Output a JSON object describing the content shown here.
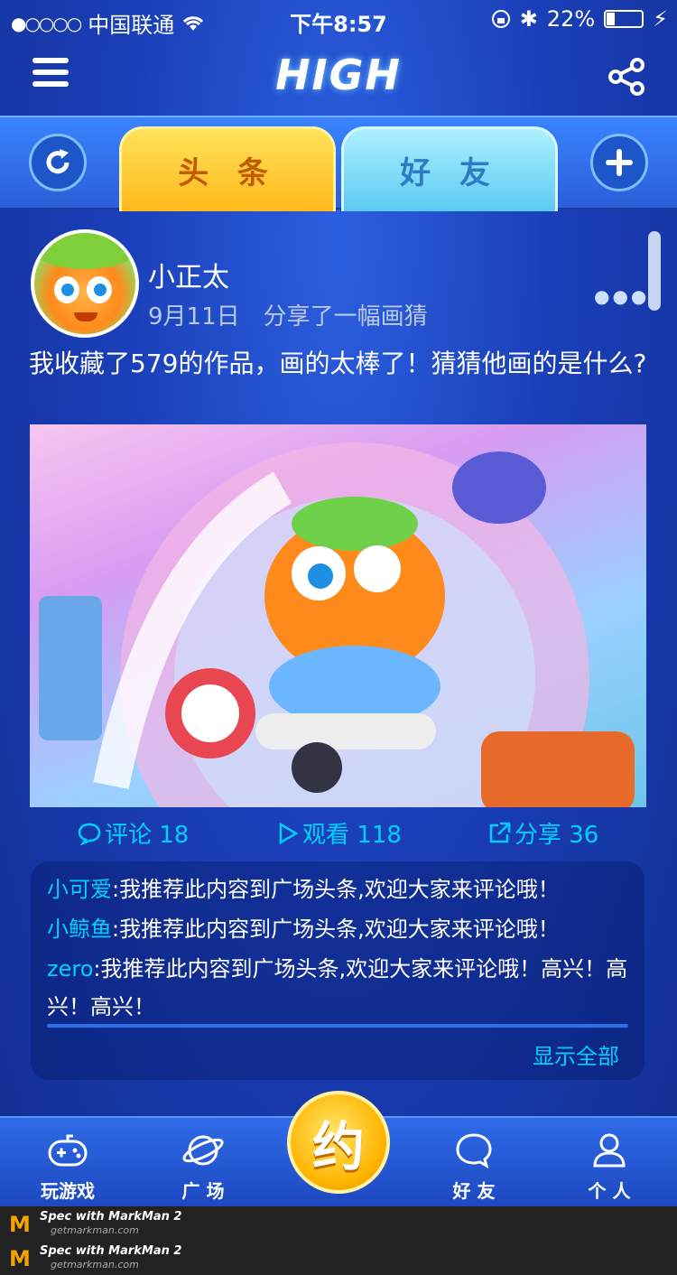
{
  "status": {
    "carrier": "中国联通",
    "time": "下午8:57",
    "battery": "22%",
    "battery_level": 0.22
  },
  "nav": {
    "title": "HIGH"
  },
  "tabs": [
    {
      "label": "头 条",
      "active": true
    },
    {
      "label": "好 友",
      "active": false
    }
  ],
  "post": {
    "username": "小正太",
    "date": "9月11日",
    "action": "分享了一幅画猜",
    "content": "我收藏了579的作品，画的太棒了！猜猜他画的是什么?",
    "actions": {
      "comment": "评论 18",
      "view": "观看 118",
      "share": "分享 36"
    }
  },
  "comments": [
    {
      "user": "小可爱",
      "text": ":我推荐此内容到广场头条,欢迎大家来评论哦！"
    },
    {
      "user": "小鲸鱼",
      "text": ":我推荐此内容到广场头条,欢迎大家来评论哦！"
    },
    {
      "user": "zero",
      "text": ":我推荐此内容到广场头条,欢迎大家来评论哦！高兴！高兴！高兴！"
    }
  ],
  "show_all": "显示全部",
  "bottom_nav": {
    "games": "玩游戏",
    "square": "广 场",
    "center": "约",
    "friends": "好 友",
    "me": "个 人"
  },
  "watermark": {
    "brand": "Spec with MarkMan 2",
    "url": "getmarkman.com"
  },
  "colors": {
    "accent": "#00d0ff",
    "tab_active": "#ffc21f",
    "tab_inactive": "#6fd3f5",
    "background": "#1a3fb8"
  }
}
